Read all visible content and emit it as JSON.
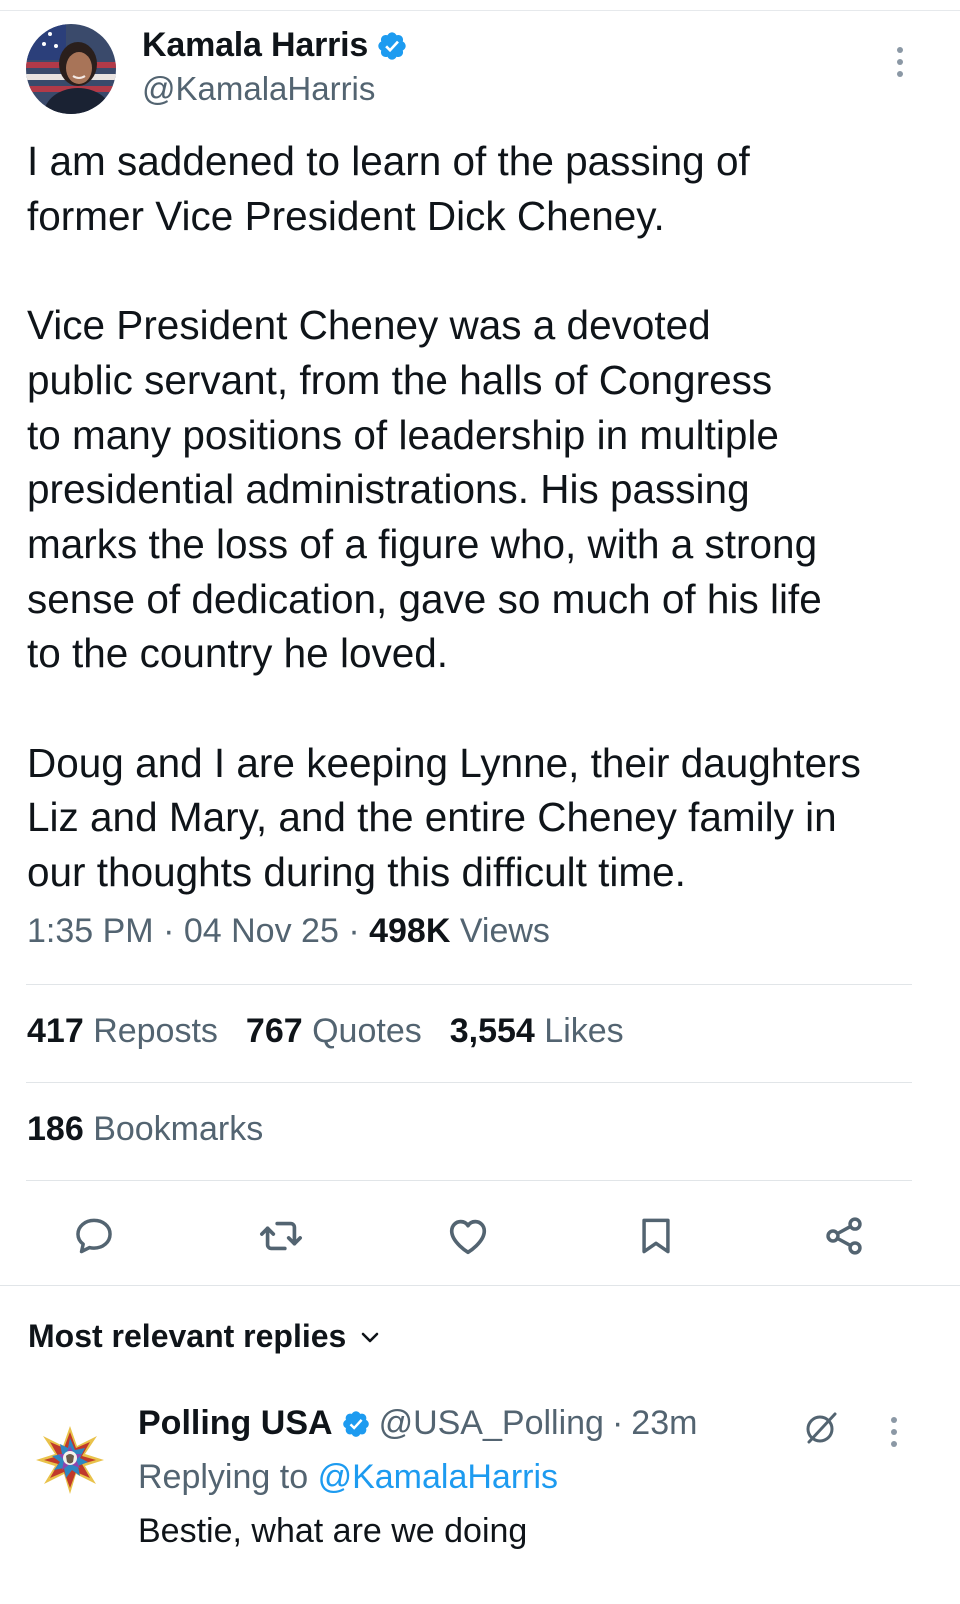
{
  "tweet": {
    "author_name": "Kamala Harris",
    "author_handle": "@KamalaHarris",
    "text": "I am saddened to learn of the passing of\nformer Vice President Dick Cheney.\n\nVice President Cheney was a devoted\npublic servant, from the halls of Congress\nto many positions of leadership in multiple\npresidential administrations. His passing\nmarks the loss of a figure who, with a strong\nsense of dedication, gave so much of his life\nto the country he loved.\n\nDoug and I are keeping Lynne, their daughters\nLiz and Mary, and the entire Cheney family in\nour thoughts during this difficult time.",
    "time": "1:35 PM",
    "date": "04 Nov 25",
    "views_count": "498K",
    "views_label": "Views",
    "separator": "·"
  },
  "stats": {
    "reposts_count": "417",
    "reposts_label": "Reposts",
    "quotes_count": "767",
    "quotes_label": "Quotes",
    "likes_count": "3,554",
    "likes_label": "Likes",
    "bookmarks_count": "186",
    "bookmarks_label": "Bookmarks"
  },
  "actions": [
    "reply-icon",
    "repost-icon",
    "like-icon",
    "bookmark-icon",
    "share-icon"
  ],
  "replies": {
    "sort_label": "Most relevant replies"
  },
  "reply": {
    "author_name": "Polling USA",
    "author_handle": "@USA_Polling",
    "separator": "·",
    "time": "23m",
    "replying_prefix": "Replying to",
    "replying_to": "@KamalaHarris",
    "text": "Bestie, what are we doing"
  },
  "colors": {
    "verified": "#1d9bf0",
    "link": "#1d9bf0",
    "secondary_text": "#536471",
    "primary_text": "#0f1419",
    "divider": "#e1e5e8"
  }
}
